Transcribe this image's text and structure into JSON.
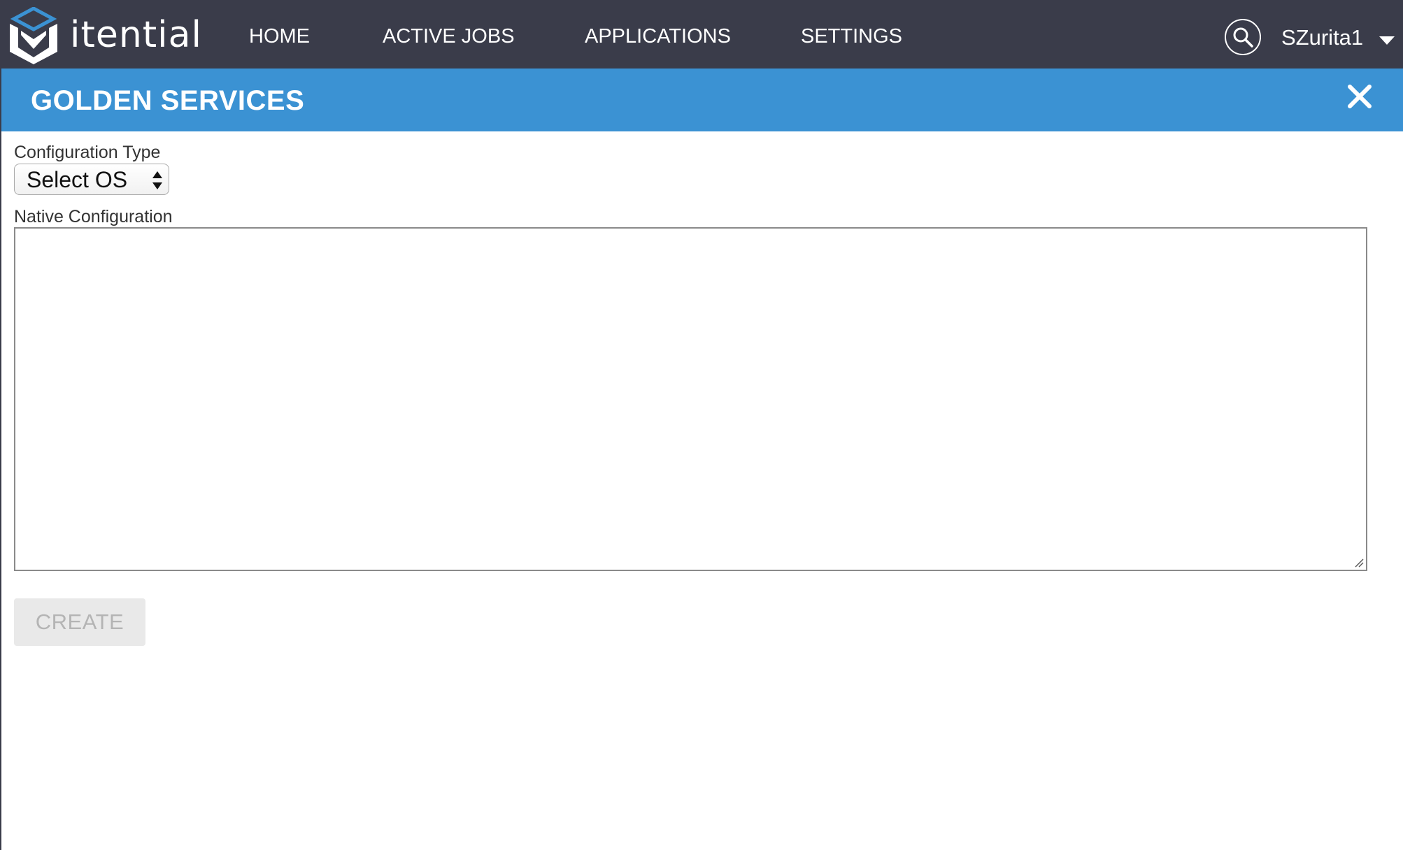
{
  "brand": {
    "name": "itential"
  },
  "nav": {
    "items": [
      {
        "label": "HOME"
      },
      {
        "label": "ACTIVE JOBS"
      },
      {
        "label": "APPLICATIONS"
      },
      {
        "label": "SETTINGS"
      }
    ],
    "user": "SZurita1",
    "icons": {
      "search": "search-icon",
      "user_menu": "chevron-down-icon"
    }
  },
  "panel": {
    "title": "GOLDEN SERVICES",
    "close_icon": "close-icon"
  },
  "form": {
    "config_type_label": "Configuration Type",
    "config_type_value": "Select OS",
    "native_config_label": "Native Configuration",
    "native_config_value": "",
    "create_label": "CREATE"
  },
  "colors": {
    "nav_bg": "#3a3c4a",
    "titlebar_bg": "#3b92d3",
    "logo_accent": "#3b92d3",
    "brand_accent": "#e8734a",
    "button_disabled_bg": "#e9e9e9",
    "button_disabled_text": "#b4b4b4"
  }
}
